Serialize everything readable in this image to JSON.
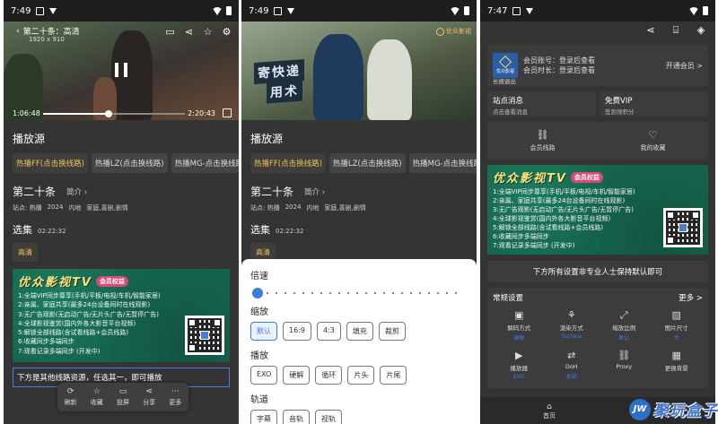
{
  "phone1": {
    "status_time": "7:49",
    "video": {
      "title": "第二十条：高清",
      "resolution": "1920 x 910",
      "time_elapsed": "1:06:48",
      "time_total": "2:20:43",
      "progress": 0.46
    },
    "source_title": "播放源",
    "lines": [
      "热播FF(点击换线路)",
      "热播LZ(点击换线路)",
      "热播MG-点击换线路"
    ],
    "episode_title": "第二十条",
    "brief_label": "简介",
    "meta": [
      "站点: 热播",
      "2024",
      "内地",
      "家庭,喜剧,剧情"
    ],
    "collection_label": "选集",
    "collection_duration": "02:22:32",
    "quality": "高清",
    "hint": "下方是其他线路资源，任选其一，即可播放",
    "float_actions": [
      {
        "icon": "refresh-icon",
        "label": "刷新"
      },
      {
        "icon": "star-icon",
        "label": "收藏"
      },
      {
        "icon": "cast-icon",
        "label": "投屏"
      },
      {
        "icon": "share-icon",
        "label": "分享"
      },
      {
        "icon": "more-icon",
        "label": "更多"
      }
    ]
  },
  "banner": {
    "title": "优众影视TV",
    "badge": "会员权益",
    "items": [
      "1:全端VIP同步尊享(手机/平板/电视/车机/智能家居)",
      "2:亲属、家庭共享(最多24台设备同时在线观影)",
      "3:无广告观影(无启动广告/无片头广告/无暂停广告)",
      "4:全球影视鉴赏(国内外各大影音平台视频)",
      "5:解锁全部线路(含试看线路+会员线路)",
      "6:收藏同步多端同步",
      "7:观看记录多端同步 (开发中)"
    ]
  },
  "phone2": {
    "status_time": "7:49",
    "brand": "优众影视",
    "source_title": "播放源",
    "lines": [
      "热播FF(点击换线路)",
      "热播LZ(点击换线路)",
      "热播MG-点击换线路"
    ],
    "episode_title": "第二十条",
    "brief_label": "简介",
    "meta": [
      "站点: 热播",
      "2024",
      "内地",
      "家庭,喜剧,剧情"
    ],
    "collection_label": "选集",
    "collection_duration": "02:22:32",
    "quality": "高清",
    "sheet": {
      "speed_label": "倍速",
      "speed_value": 0.0,
      "scale_label": "缩放",
      "scale_options": [
        "默认",
        "16:9",
        "4:3",
        "填充",
        "裁剪"
      ],
      "scale_selected": "默认",
      "play_label": "播放",
      "play_options": [
        "EXO",
        "硬解",
        "循环",
        "片头",
        "片尾"
      ],
      "track_label": "轨道",
      "track_options": [
        "字幕",
        "音轨",
        "视轨"
      ]
    }
  },
  "phone3": {
    "status_time": "7:47",
    "account": {
      "logo_text": "优众影视",
      "account_label": "会员账号：登录后查看",
      "duration_label": "会员时长：登录后查看",
      "open_label": "开通会员 >",
      "exit_label": "长按退出"
    },
    "site_msg": {
      "title": "站点消息",
      "sub": "点击查看消息"
    },
    "free_vip": {
      "title": "免费VIP",
      "sub": "签到领积分"
    },
    "links": [
      {
        "icon": "link-icon",
        "label": "会员线路"
      },
      {
        "icon": "heart-icon",
        "label": "我的收藏"
      }
    ],
    "settings_hint": "下方所有设置非专业人士保持默认即可",
    "general": {
      "title": "常规设置",
      "more": "更多 >",
      "items": [
        {
          "icon": "decode-icon",
          "label": "解码方式",
          "value": "硬解"
        },
        {
          "icon": "render-icon",
          "label": "渲染方式",
          "value": "Surface"
        },
        {
          "icon": "scale-icon",
          "label": "缩放比例",
          "value": "默认"
        },
        {
          "icon": "image-icon",
          "label": "图片尺寸",
          "value": "大"
        },
        {
          "icon": "player-icon",
          "label": "播放器",
          "value": "EXO"
        },
        {
          "icon": "doh-icon",
          "label": "DoH",
          "value": "系统"
        },
        {
          "icon": "proxy-icon",
          "label": "Proxy",
          "value": ""
        },
        {
          "icon": "background-icon",
          "label": "更换背景",
          "value": ""
        }
      ]
    },
    "home_label": "首页"
  },
  "watermark": {
    "logo": "JW",
    "text": "聚玩盒子"
  }
}
